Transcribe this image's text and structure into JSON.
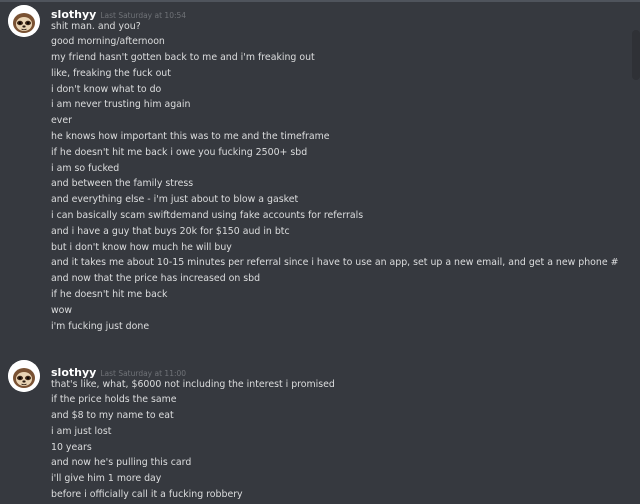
{
  "messages": [
    {
      "author": "slothyy",
      "timestamp": "Last Saturday at 10:54",
      "avatar_icon": "sloth-avatar-icon",
      "lines": [
        "shit man. and you?",
        "good morning/afternoon",
        "my friend hasn't gotten back to me and i'm freaking out",
        "like, freaking the fuck out",
        "i don't know what to do",
        "i am never trusting him again",
        "ever",
        "he knows how important this was to me and the timeframe",
        "if he doesn't hit me back i owe you fucking 2500+ sbd",
        "i am so fucked",
        "and between the family stress",
        "and everything else - i'm just about to blow a gasket",
        "i can basically scam swiftdemand using fake accounts for referrals",
        "and i have a guy that buys 20k for $150 aud in btc",
        "but i don't know how much he will buy",
        "and it takes me about 10-15 minutes per referral since i have to use an app, set up a new email, and get a new phone #",
        "and now that the price has increased on sbd",
        "if he doesn't hit me back",
        "wow",
        "i'm fucking just done"
      ]
    },
    {
      "author": "slothyy",
      "timestamp": "Last Saturday at 11:00",
      "avatar_icon": "sloth-avatar-icon",
      "lines": [
        "that's like, what, $6000 not including the interest i promised",
        "if the price holds the same",
        "and $8 to my name to eat",
        "i am just lost",
        "10 years",
        "and now he's pulling this card",
        "i'll give him 1 more day",
        "before i officially call it a fucking robbery"
      ]
    }
  ],
  "colors": {
    "background": "#36393f",
    "username": "#ffffff",
    "timestamp": "#6f7277",
    "message_text": "#dcddde"
  }
}
